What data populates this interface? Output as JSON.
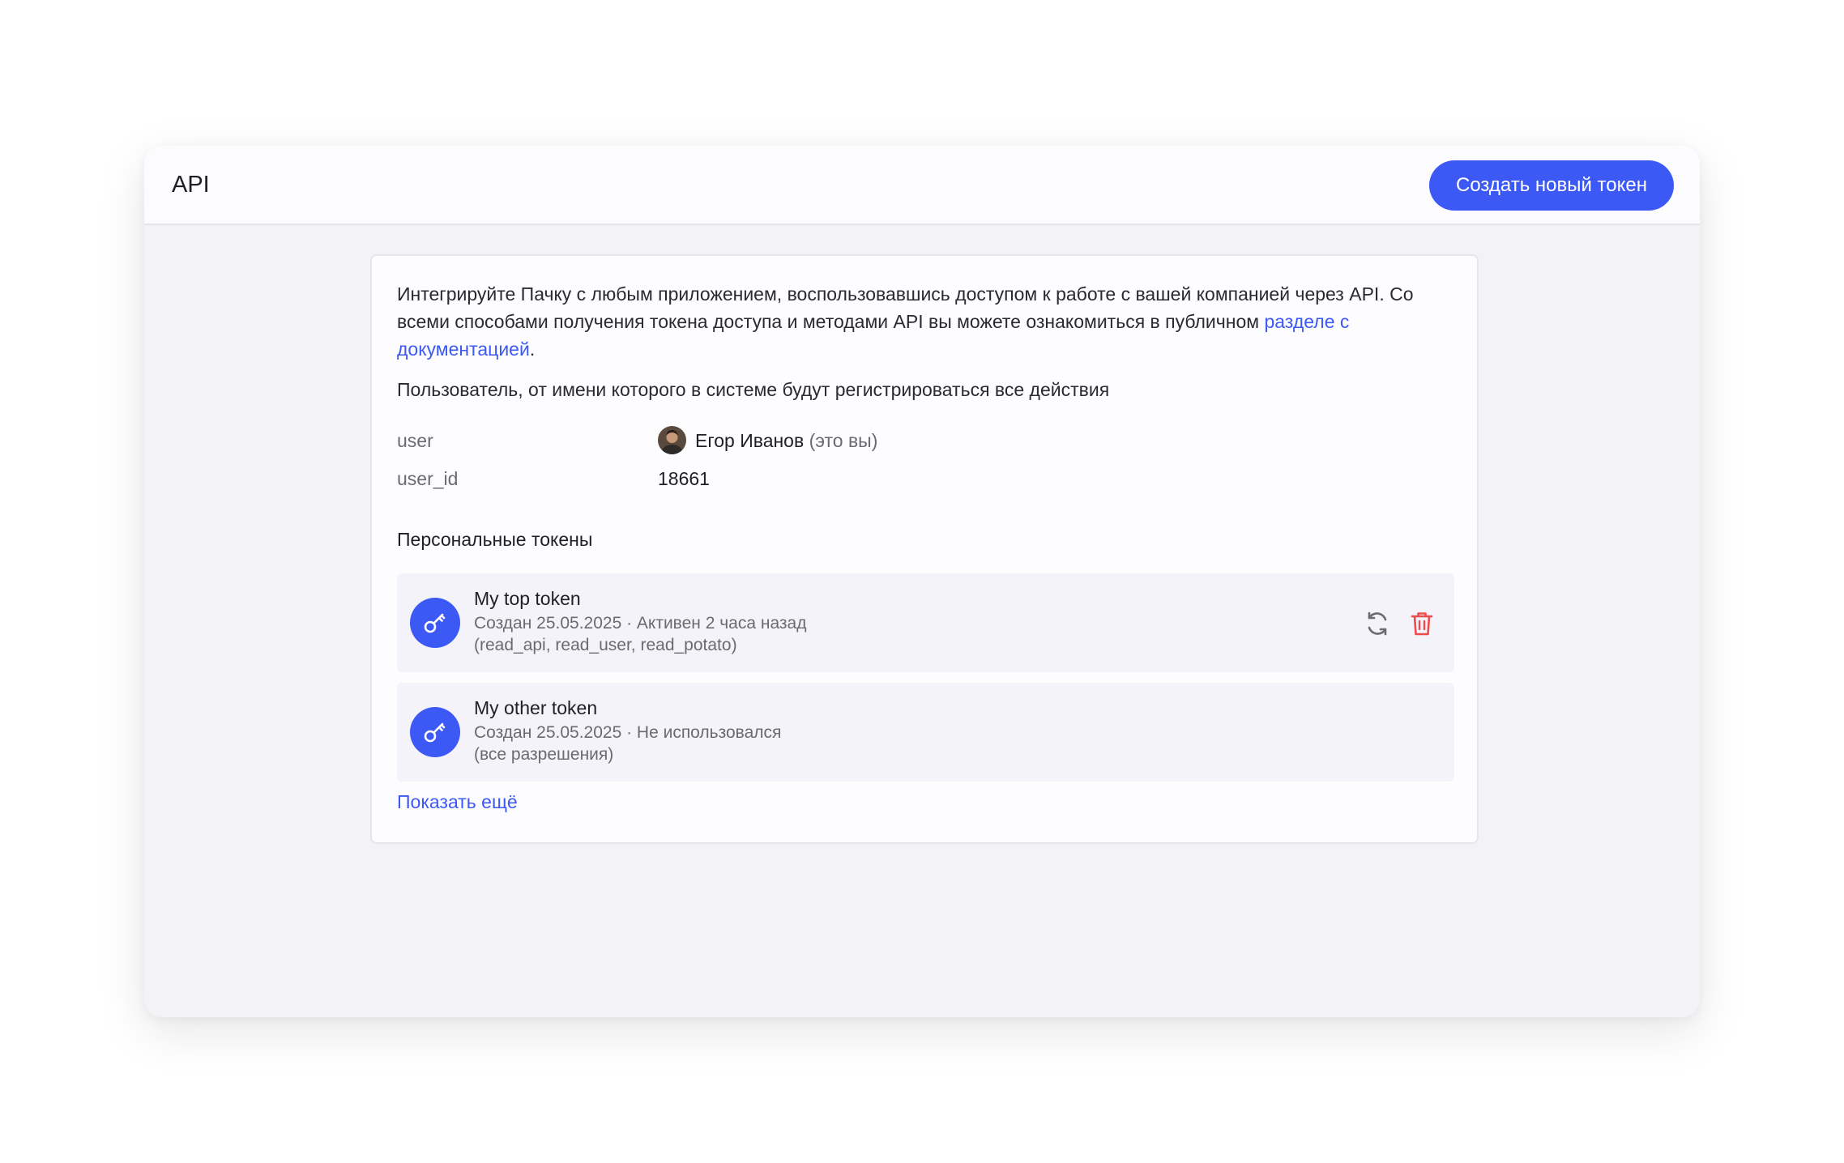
{
  "header": {
    "title": "API",
    "create_button_label": "Создать новый токен"
  },
  "intro": {
    "text_before_link": "Интегрируйте Пачку с любым приложением, воспользовавшись доступом к работе с вашей компанией через API. Со всеми способами получения токена доступа и методами API вы можете ознакомиться в публичном ",
    "link_text": "разделе с документацией",
    "text_after_link": "."
  },
  "user_note": "Пользователь, от имени которого в системе будут регистрироваться все действия",
  "fields": {
    "user_label": "user",
    "user_name": "Егор Иванов",
    "user_you": "(это вы)",
    "user_id_label": "user_id",
    "user_id_value": "18661"
  },
  "tokens_section": {
    "title": "Персональные токены",
    "tokens": [
      {
        "name": "My top token",
        "meta": "Создан 25.05.2025 · Активен 2 часа назад",
        "scopes": "(read_api, read_user, read_potato)",
        "icon": "key-icon",
        "actions": [
          "refresh-icon",
          "trash-icon"
        ]
      },
      {
        "name": "My other token",
        "meta": "Создан 25.05.2025 · Не использовался",
        "scopes": "(все разрешения)",
        "icon": "key-icon",
        "actions": []
      }
    ],
    "show_more_label": "Показать ещё"
  },
  "colors": {
    "accent": "#3c59f5",
    "danger": "#ee4c4c",
    "muted": "#6a6a74"
  }
}
